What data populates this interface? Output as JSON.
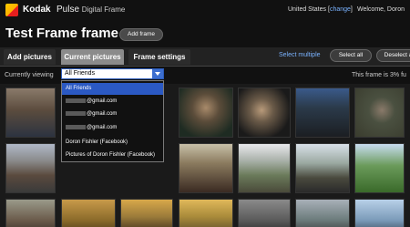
{
  "header": {
    "brand": "Kodak",
    "product": "Pulse",
    "product_sub": "Digital Frame",
    "region": "United States",
    "region_link": "change",
    "welcome": "Welcome, Doron"
  },
  "title": {
    "page_title": "Test Frame frame",
    "add_frame_label": "Add frame"
  },
  "tabs": [
    {
      "label": "Add pictures"
    },
    {
      "label": "Current pictures"
    },
    {
      "label": "Frame settings"
    }
  ],
  "actions": {
    "select_multiple": "Select multiple",
    "select_all": "Select all",
    "deselect": "Deselect a"
  },
  "viewing": {
    "label": "Currently viewing",
    "selected": "All Friends",
    "options": [
      "All Friends",
      "@gmail.com",
      "@gmail.com",
      "@gmail.com",
      "Doron Fishler (Facebook)",
      "Pictures of Doron Fishler (Facebook)"
    ]
  },
  "frame_status": "This frame is 3% fu",
  "colors": {
    "selected_tab": "#8b8b8b",
    "link": "#7ab3ff",
    "dropdown_highlight": "#2b59c3"
  }
}
